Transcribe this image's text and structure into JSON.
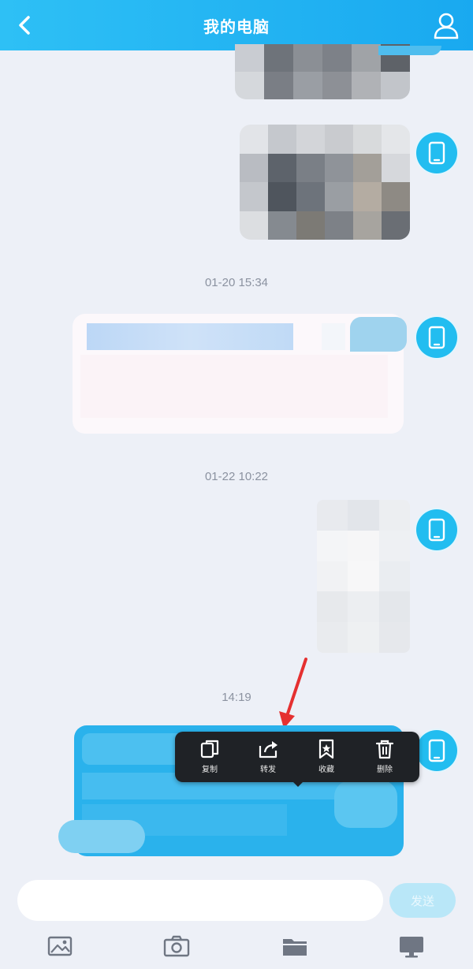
{
  "header": {
    "title": "我的电脑",
    "back_icon": "chevron-left-icon",
    "user_icon": "user-icon"
  },
  "timestamps": [
    "01-20 15:34",
    "01-22 10:22",
    "14:19"
  ],
  "context_menu": {
    "items": [
      {
        "label": "复制",
        "icon": "copy-icon"
      },
      {
        "label": "转发",
        "icon": "share-icon"
      },
      {
        "label": "收藏",
        "icon": "bookmark-icon"
      },
      {
        "label": "删除",
        "icon": "trash-icon"
      }
    ]
  },
  "composer": {
    "input_value": "",
    "send_label": "发送"
  },
  "toolbar": {
    "items": [
      "image-icon",
      "camera-icon",
      "folder-icon",
      "computer-icon"
    ]
  },
  "colors": {
    "header": "#1eb1f2",
    "accent": "#22bdf0",
    "menu": "#1f2226",
    "arrow": "#e53030"
  }
}
